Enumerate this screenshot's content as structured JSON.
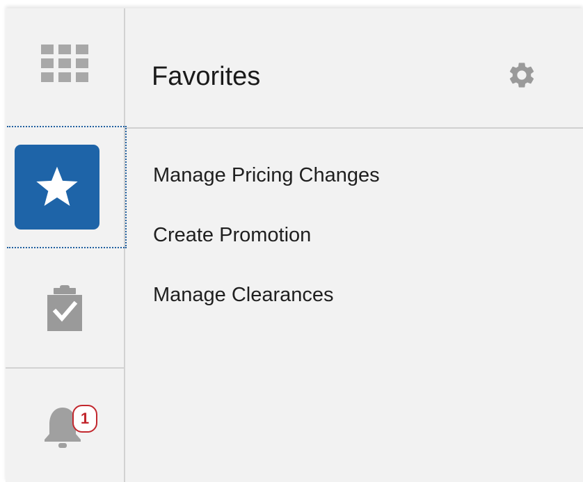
{
  "rail": {
    "items": [
      {
        "icon": "app-grid-icon",
        "selected": false
      },
      {
        "icon": "star-icon",
        "selected": true,
        "accent": "#1e64a8"
      },
      {
        "icon": "clipboard-check-icon",
        "selected": false
      },
      {
        "icon": "bell-icon",
        "selected": false,
        "badge": "1",
        "badge_color": "#c2272d"
      }
    ]
  },
  "panel": {
    "title": "Favorites",
    "settings_icon": "gear-icon",
    "items": [
      {
        "label": "Manage Pricing Changes"
      },
      {
        "label": "Create Promotion"
      },
      {
        "label": "Manage Clearances"
      }
    ]
  }
}
